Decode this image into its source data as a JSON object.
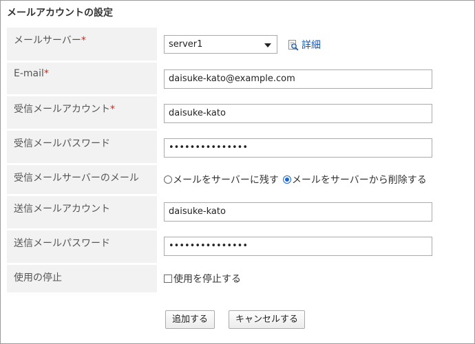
{
  "page": {
    "title": "メールアカウントの設定"
  },
  "rows": {
    "server": {
      "label": "メールサーバー",
      "required": "*",
      "selected": "server1",
      "detail_label": "詳細"
    },
    "email": {
      "label": "E-mail",
      "required": "*",
      "value": "daisuke-kato@example.com"
    },
    "receive_account": {
      "label": "受信メールアカウント",
      "required": "*",
      "value": "daisuke-kato"
    },
    "receive_password": {
      "label": "受信メールパスワード",
      "value": "•••••••••••••••"
    },
    "receive_server_mail": {
      "label": "受信メールサーバーのメール",
      "options": [
        {
          "label": "メールをサーバーに残す",
          "checked": false
        },
        {
          "label": "メールをサーバーから削除する",
          "checked": true
        }
      ]
    },
    "send_account": {
      "label": "送信メールアカウント",
      "value": "daisuke-kato"
    },
    "send_password": {
      "label": "送信メールパスワード",
      "value": "•••••••••••••••"
    },
    "disable": {
      "label": "使用の停止",
      "checkbox_label": "使用を停止する",
      "checked": false
    }
  },
  "buttons": {
    "add": "追加する",
    "cancel": "キャンセルする"
  },
  "icons": {
    "detail": "magnifier-document-icon",
    "dropdown": "chevron-down-icon"
  },
  "colors": {
    "required": "#e0201d",
    "link": "#1a56b0",
    "label_bg": "#f2f2f2",
    "radio_on": "#1a66d9"
  }
}
